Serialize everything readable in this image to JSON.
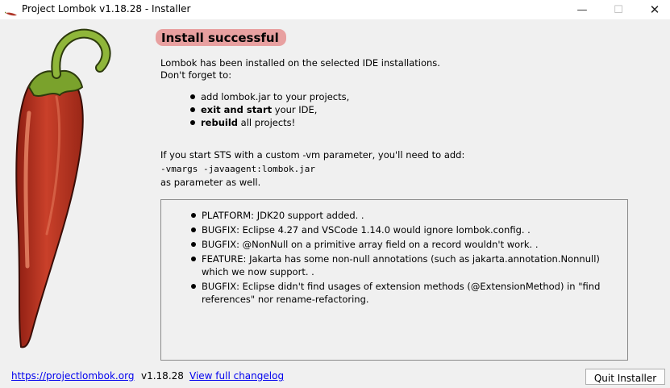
{
  "window": {
    "title": "Project Lombok v1.18.28 - Installer",
    "controls": {
      "minimize": "—",
      "maximize": "☐",
      "close": "✕"
    }
  },
  "main": {
    "headline": "Install successful",
    "intro_line1": "Lombok has been installed on the selected IDE installations.",
    "intro_line2": "Don't forget to:",
    "todo": [
      {
        "bold": "",
        "text": "add lombok.jar to your projects,"
      },
      {
        "bold": "exit and start",
        "text": " your IDE,"
      },
      {
        "bold": "rebuild",
        "text": " all projects!"
      }
    ],
    "sts_line1": "If you start STS with a custom -vm parameter, you'll need to add:",
    "sts_line2": "-vmargs -javaagent:lombok.jar",
    "sts_line3": "as parameter as well."
  },
  "changelog": {
    "items": [
      "PLATFORM: JDK20 support added. .",
      "BUGFIX: Eclipse 4.27 and VSCode 1.14.0 would ignore lombok.config. .",
      "BUGFIX: @NonNull on a primitive array field on a record wouldn't work. .",
      "FEATURE: Jakarta has some non-null annotations (such as jakarta.annotation.Nonnull) which we now support. .",
      "BUGFIX: Eclipse didn't find usages of extension methods (@ExtensionMethod) in \"find references\" nor rename-refactoring."
    ]
  },
  "footer": {
    "website_link": "https://projectlombok.org",
    "version": "v1.18.28",
    "changelog_link": "View full changelog",
    "quit_button": "Quit Installer"
  },
  "colors": {
    "background": "#f0f0f0",
    "headline_highlight": "#e8a0a0",
    "link": "#0000ee",
    "pepper_red": "#c0392b",
    "stem_green": "#7aa22c"
  },
  "icons": {
    "app": "chili-pepper-icon",
    "illustration": "chili-pepper-illustration"
  }
}
